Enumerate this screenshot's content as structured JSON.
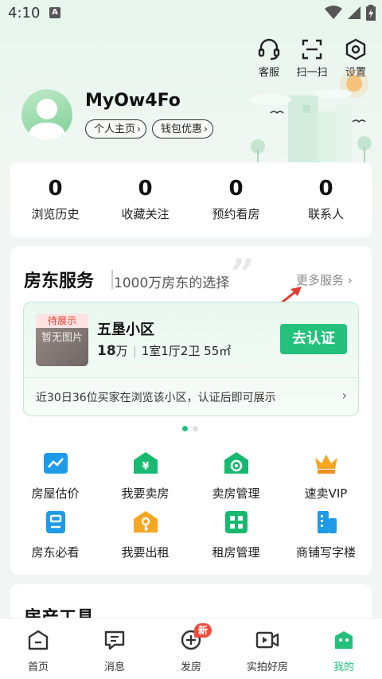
{
  "status_bar": {
    "time": "4:10",
    "notification_letter": "A"
  },
  "top_tools": [
    {
      "label": "客服",
      "icon": "headset-icon"
    },
    {
      "label": "扫一扫",
      "icon": "scan-icon"
    },
    {
      "label": "设置",
      "icon": "settings-icon"
    }
  ],
  "profile": {
    "username": "MyOw4Fo",
    "homepage_label": "个人主页",
    "wallet_label": "钱包优惠"
  },
  "stats": [
    {
      "value": "0",
      "label": "浏览历史"
    },
    {
      "value": "0",
      "label": "收藏关注"
    },
    {
      "value": "0",
      "label": "预约看房"
    },
    {
      "value": "0",
      "label": "联系人"
    }
  ],
  "landlord": {
    "title": "房东服务",
    "subtitle": "1000万房东的选择",
    "more_label": "更多服务",
    "listing": {
      "status_tag": "待展示",
      "placeholder_text": "暂无图片",
      "community": "五垦小区",
      "price_value": "18",
      "price_unit": "万",
      "layout": "1室1厅2卫 55㎡",
      "verify_label": "去认证",
      "note": "近30日36位买家在浏览该小区，认证后即可展示"
    },
    "services": [
      {
        "label": "房屋估价",
        "icon": "valuation-icon"
      },
      {
        "label": "我要卖房",
        "icon": "sell-house-icon"
      },
      {
        "label": "卖房管理",
        "icon": "sale-management-icon"
      },
      {
        "label": "速卖VIP",
        "icon": "crown-icon"
      },
      {
        "label": "房东必看",
        "icon": "guide-icon"
      },
      {
        "label": "我要出租",
        "icon": "rent-out-icon"
      },
      {
        "label": "租房管理",
        "icon": "rental-management-icon"
      },
      {
        "label": "商铺写字楼",
        "icon": "office-building-icon"
      }
    ]
  },
  "property_tools": {
    "title": "房产工具"
  },
  "bottom_nav": [
    {
      "label": "首页",
      "icon": "home-icon"
    },
    {
      "label": "消息",
      "icon": "message-icon"
    },
    {
      "label": "发房",
      "icon": "add-listing-icon",
      "badge": "新"
    },
    {
      "label": "实拍好房",
      "icon": "video-icon"
    },
    {
      "label": "我的",
      "icon": "profile-icon",
      "active": true
    }
  ],
  "colors": {
    "accent": "#23c17b",
    "tag_red": "#e23d33",
    "badge_red": "#f24a3b"
  }
}
